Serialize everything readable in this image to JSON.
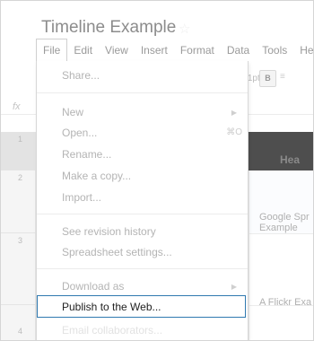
{
  "doc": {
    "title": "Timeline Example",
    "star_glyph": "☆"
  },
  "menubar": {
    "items": [
      "File",
      "Edit",
      "View",
      "Insert",
      "Format",
      "Data",
      "Tools",
      "He"
    ]
  },
  "toolbar": {
    "font_size": "11pt",
    "font_size_caret": "⇕",
    "bold_label": "B",
    "more_label": "≡"
  },
  "formula_bar": {
    "fx_label": "fx"
  },
  "rows": {
    "numbers": [
      "1",
      "2",
      "3",
      "4"
    ]
  },
  "sheet": {
    "header_cell": "Hea",
    "cell_row2": [
      "Google Spr",
      "Example"
    ],
    "cell_row4": "A Flickr Exa"
  },
  "file_menu": {
    "share": "Share...",
    "new": "New",
    "new_arrow": "▶",
    "open": "Open...",
    "open_shortcut": "⌘O",
    "rename": "Rename...",
    "make_copy": "Make a copy...",
    "import": "Import...",
    "revision_history": "See revision history",
    "spreadsheet_settings": "Spreadsheet settings...",
    "download_as": "Download as",
    "download_arrow": "▶",
    "publish": "Publish to the Web...",
    "email_collaborators": "Email collaborators..."
  },
  "colors": {
    "highlight_border": "#2f79b0",
    "dark_header": "#4e4e4e"
  }
}
